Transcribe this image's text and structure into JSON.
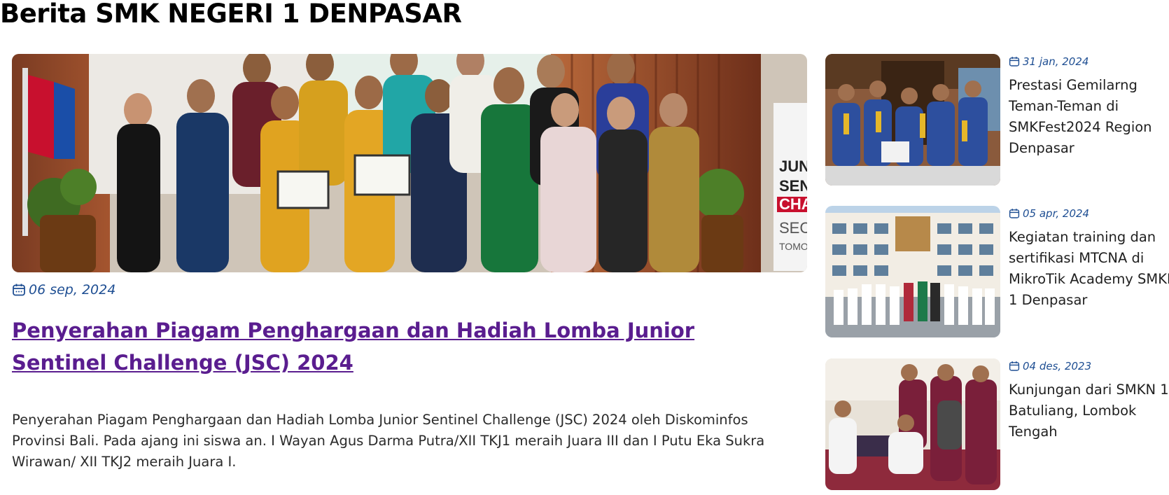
{
  "page": {
    "title": "Berita SMK NEGERI 1 DENPASAR"
  },
  "featured": {
    "date": "06 sep, 2024",
    "title": "Penyerahan Piagam Penghargaan dan Hadiah Lomba Junior Sentinel Challenge (JSC) 2024",
    "summary": "Penyerahan Piagam Penghargaan dan Hadiah Lomba Junior Sentinel Challenge (JSC) 2024 oleh Diskominfos Provinsi Bali. Pada ajang ini siswa an. I Wayan Agus Darma Putra/XII TKJ1 meraih Juara III dan I Putu Eka Sukra Wirawan/ XII TKJ2 meraih Juara I.",
    "image_banner_text": [
      "JUN",
      "SENT",
      "CHAL",
      "SECU",
      "TOMO"
    ]
  },
  "side_news": [
    {
      "date": "31 jan, 2024",
      "title_lines": [
        "Prestasi Gemilarng",
        "Teman-Teman di",
        "SMKFest2024 Region",
        "Denpasar"
      ]
    },
    {
      "date": "05 apr, 2024",
      "title_lines": [
        "Kegiatan training dan",
        "sertifikasi MTCNA di",
        "MikroTik Academy SMKN",
        "1 Denpasar"
      ]
    },
    {
      "date": "04 des, 2023",
      "title_lines": [
        "Kunjungan dari SMKN 1",
        "Batuliang, Lombok",
        "Tengah"
      ]
    }
  ],
  "icons": {
    "date": "calendar-icon"
  },
  "colors": {
    "date": "#1f4f93",
    "link": "#5a1d8f",
    "text": "#1f1f1f"
  }
}
